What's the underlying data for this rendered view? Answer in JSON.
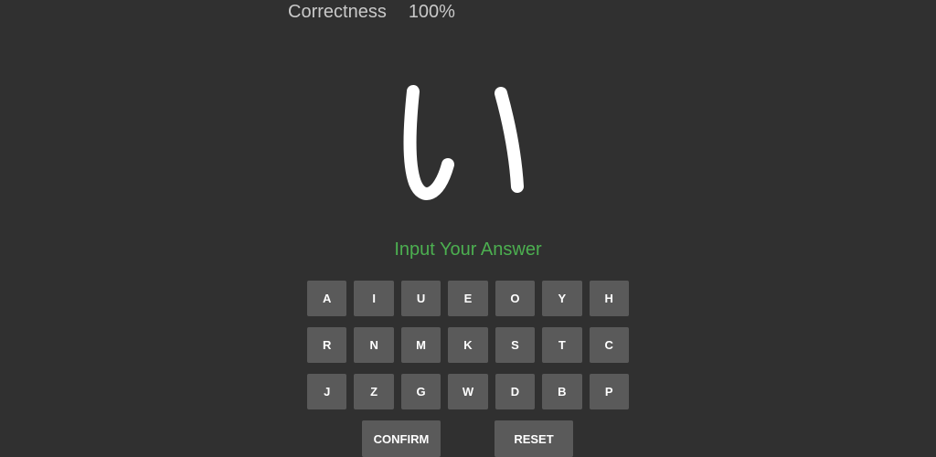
{
  "header": {
    "correctness_label": "Correctness",
    "correctness_value": "100%"
  },
  "kana_glyph": "い",
  "prompt": "Input Your Answer",
  "keyboard": {
    "rows": [
      [
        "A",
        "I",
        "U",
        "E",
        "O",
        "Y",
        "H"
      ],
      [
        "R",
        "N",
        "M",
        "K",
        "S",
        "T",
        "C"
      ],
      [
        "J",
        "Z",
        "G",
        "W",
        "D",
        "B",
        "P"
      ]
    ]
  },
  "actions": {
    "confirm_label": "CONFIRM",
    "reset_label": "RESET"
  },
  "colors": {
    "background": "#303030",
    "prompt": "#4caf50",
    "key": "#5a5a5a",
    "glyph": "#ffffff"
  }
}
